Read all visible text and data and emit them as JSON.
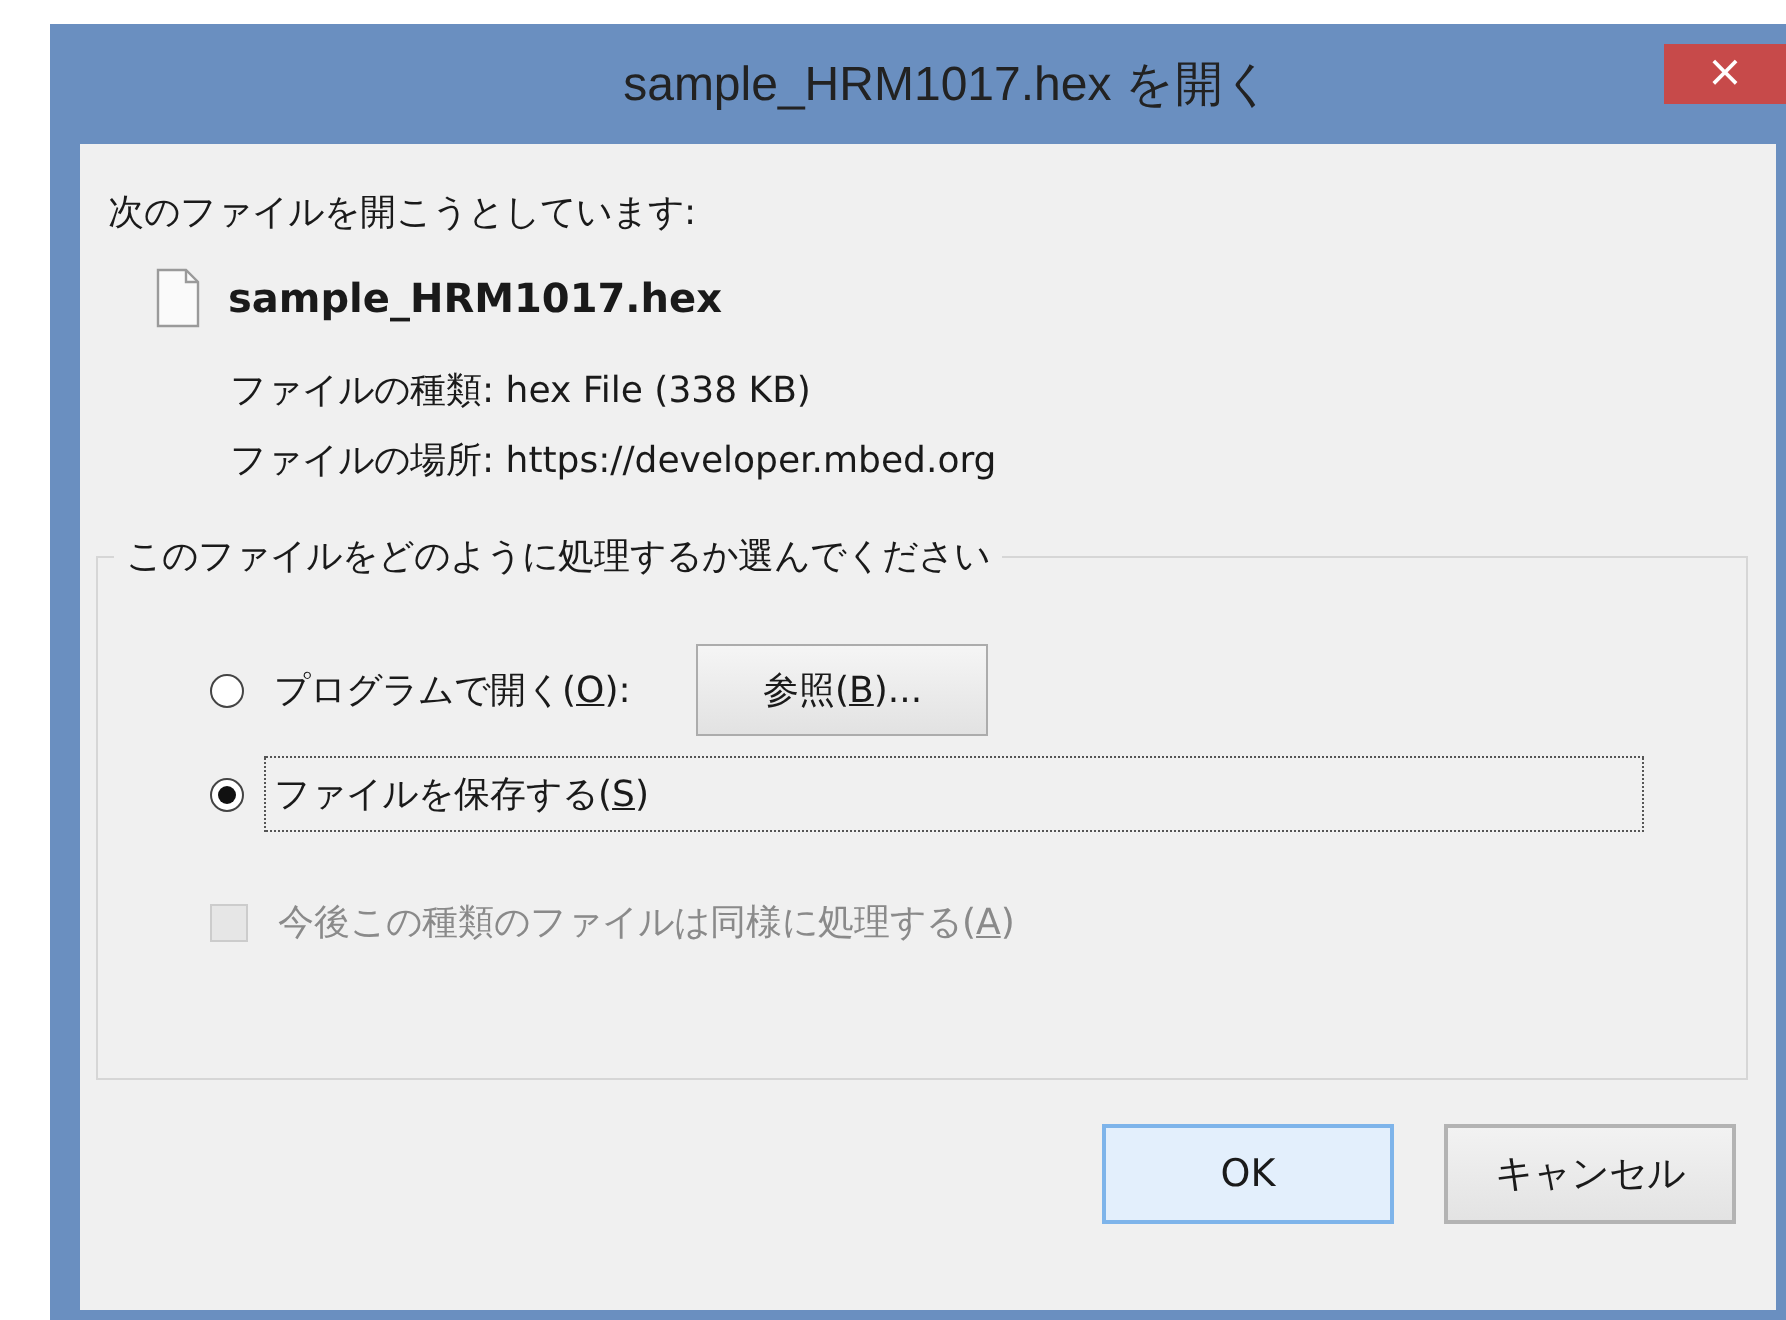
{
  "window": {
    "title": "sample_HRM1017.hex を開く",
    "close": "×"
  },
  "intro": "次のファイルを開こうとしています:",
  "file": {
    "name": "sample_HRM1017.hex",
    "details": [
      "ファイルの種類: hex File (338 KB)",
      "ファイルの場所: https://developer.mbed.org"
    ]
  },
  "group": {
    "legend": "このファイルをどのように処理するか選んでください",
    "options": [
      {
        "before": "プログラムで開く(",
        "key": "O",
        "after": "):",
        "selected": false,
        "focused": false,
        "button": {
          "before": "参照(",
          "key": "B",
          "after": ")..."
        }
      },
      {
        "before": "ファイルを保存する(",
        "key": "S",
        "after": ")",
        "selected": true,
        "focused": true
      }
    ],
    "remember": {
      "before": "今後この種類のファイルは同様に処理する(",
      "key": "A",
      "after": ")",
      "checked": false,
      "disabled": true
    }
  },
  "buttons": [
    {
      "label": "OK",
      "default": true
    },
    {
      "label": "キャンセル",
      "default": false
    }
  ]
}
